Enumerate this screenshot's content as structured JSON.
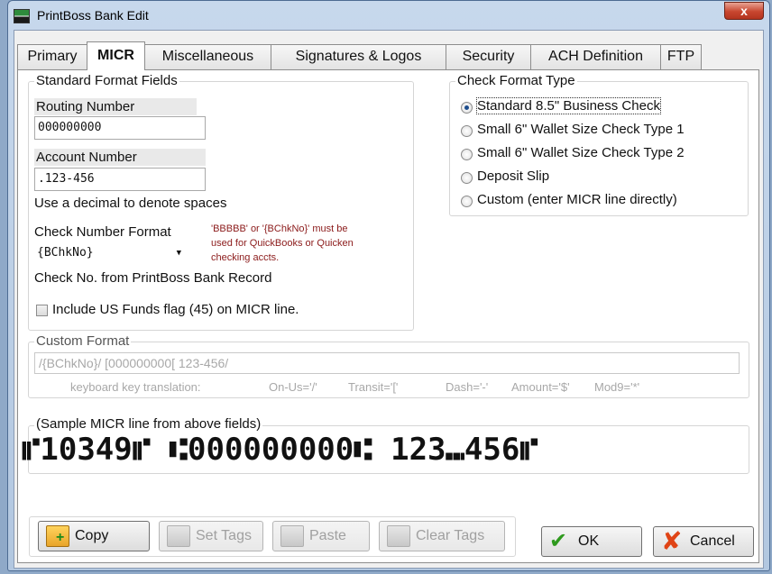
{
  "window": {
    "title": "PrintBoss Bank Edit",
    "close_glyph": "x"
  },
  "tabs": [
    "Primary",
    "MICR",
    "Miscellaneous",
    "Signatures & Logos",
    "Security",
    "ACH Definition",
    "FTP"
  ],
  "standard_fields": {
    "title": "Standard Format Fields",
    "routing_label": "Routing Number",
    "routing_value": "000000000",
    "account_label": "Account Number",
    "account_value": ".123-456",
    "decimal_hint": "Use a decimal to denote spaces",
    "check_number_label": "Check Number Format",
    "check_number_value": "{BChkNo}",
    "note_line1": "'BBBBB' or '{BChkNo}' must be",
    "note_line2": "used for QuickBooks or Quicken",
    "note_line3": "checking accts.",
    "check_no_source": "Check No. from PrintBoss Bank Record",
    "us_funds_label": "Include US Funds flag (45) on MICR line.",
    "us_funds_checked": false
  },
  "check_format": {
    "title": "Check Format Type",
    "options": [
      "Standard 8.5\" Business Check",
      "Small  6\" Wallet Size Check Type 1",
      "Small  6\" Wallet Size Check Type 2",
      "Deposit Slip",
      "Custom (enter MICR line directly)"
    ],
    "selected_index": 0
  },
  "custom_format": {
    "title": "Custom Format",
    "value": "/{BChkNo}/ [000000000[ 123-456/",
    "help_label": "keyboard key translation:",
    "help_onus": "On-Us='/'",
    "help_transit": "Transit='['",
    "help_dash": "Dash='-'",
    "help_amount": "Amount='$'",
    "help_mod9": "Mod9='*'"
  },
  "sample": {
    "title": "(Sample MICR line from above fields)",
    "micr_line": "⑈10349⑈ ⑆000000000⑆ 123⑉456⑈"
  },
  "buttons": {
    "copy": "Copy",
    "set_tags": "Set Tags",
    "paste": "Paste",
    "clear_tags": "Clear Tags",
    "ok": "OK",
    "cancel": "Cancel"
  },
  "icons": {
    "copy": "copy-icon",
    "set_tags": "set-tags-icon",
    "paste": "paste-icon",
    "clear_tags": "clear-tags-icon",
    "ok": "checkmark-icon",
    "cancel": "cross-icon"
  }
}
